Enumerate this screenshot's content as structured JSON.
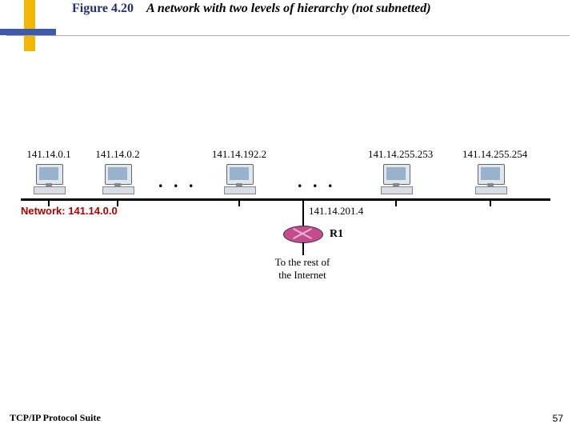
{
  "title": {
    "number": "Figure 4.20",
    "text": "A network with two levels of hierarchy (not subnetted)"
  },
  "network_label": "Network: 141.14.0.0",
  "hosts": [
    {
      "ip": "141.14.0.1"
    },
    {
      "ip": "141.14.0.2"
    },
    {
      "ip": "141.14.192.2"
    },
    {
      "ip": "141.14.255.253"
    },
    {
      "ip": "141.14.255.254"
    }
  ],
  "ellipsis": ". . .",
  "router": {
    "ip": "141.14.201.4",
    "name": "R1",
    "note_line1": "To the rest of",
    "note_line2": "the Internet"
  },
  "footer": "TCP/IP Protocol Suite",
  "page": "57"
}
